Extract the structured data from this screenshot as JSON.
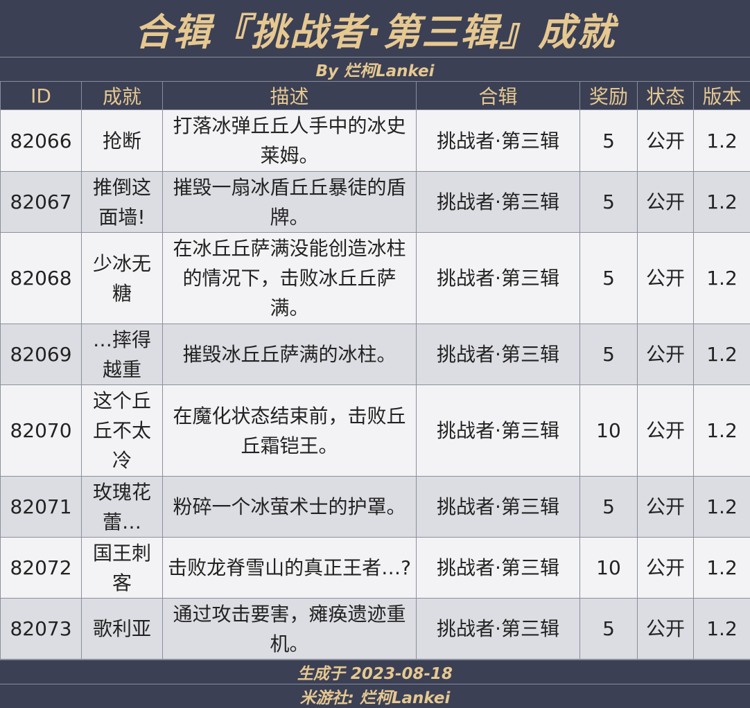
{
  "title": "合辑『挑战者·第三辑』成就",
  "byline": "By 烂柯Lankei",
  "columns": [
    "ID",
    "成就",
    "描述",
    "合辑",
    "奖励",
    "状态",
    "版本"
  ],
  "rows": [
    {
      "id": "82066",
      "name": "抢断",
      "desc": "打落冰弹丘丘人手中的冰史莱姆。",
      "collection": "挑战者·第三辑",
      "reward": "5",
      "status": "公开",
      "version": "1.2"
    },
    {
      "id": "82067",
      "name": "推倒这面墙!",
      "desc": "摧毁一扇冰盾丘丘暴徒的盾牌。",
      "collection": "挑战者·第三辑",
      "reward": "5",
      "status": "公开",
      "version": "1.2"
    },
    {
      "id": "82068",
      "name": "少冰无糖",
      "desc": "在冰丘丘萨满没能创造冰柱的情况下，击败冰丘丘萨满。",
      "collection": "挑战者·第三辑",
      "reward": "5",
      "status": "公开",
      "version": "1.2"
    },
    {
      "id": "82069",
      "name": "…摔得越重",
      "desc": "摧毁冰丘丘萨满的冰柱。",
      "collection": "挑战者·第三辑",
      "reward": "5",
      "status": "公开",
      "version": "1.2"
    },
    {
      "id": "82070",
      "name": "这个丘丘不太冷",
      "desc": "在魔化状态结束前，击败丘丘霜铠王。",
      "collection": "挑战者·第三辑",
      "reward": "10",
      "status": "公开",
      "version": "1.2"
    },
    {
      "id": "82071",
      "name": "玫瑰花蕾…",
      "desc": "粉碎一个冰萤术士的护罩。",
      "collection": "挑战者·第三辑",
      "reward": "5",
      "status": "公开",
      "version": "1.2"
    },
    {
      "id": "82072",
      "name": "国王刺客",
      "desc": "击败龙脊雪山的真正王者…?",
      "collection": "挑战者·第三辑",
      "reward": "10",
      "status": "公开",
      "version": "1.2"
    },
    {
      "id": "82073",
      "name": "歌利亚",
      "desc": "通过攻击要害，瘫痪遗迹重机。",
      "collection": "挑战者·第三辑",
      "reward": "5",
      "status": "公开",
      "version": "1.2"
    }
  ],
  "footer": {
    "generated": "生成于 2023-08-18",
    "source": "米游社: 烂柯Lankei"
  }
}
